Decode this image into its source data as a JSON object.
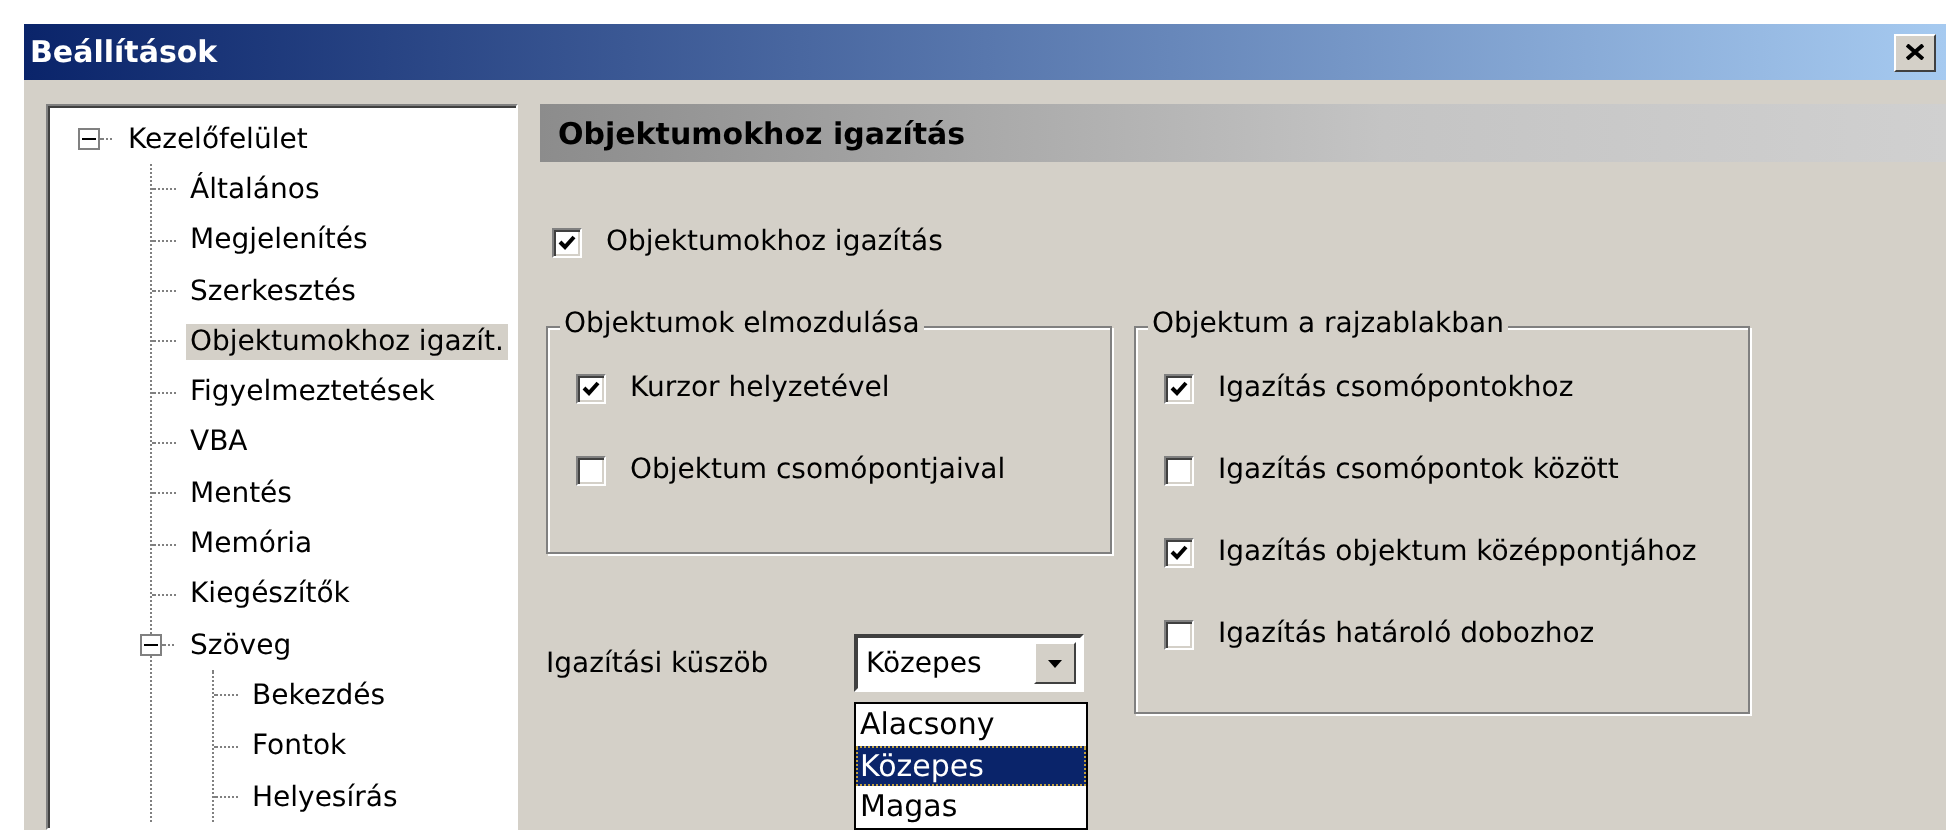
{
  "window": {
    "title": "Beállítások"
  },
  "tree": [
    {
      "label": "Kezelőfelület",
      "expanded": true,
      "selected": false,
      "children": [
        {
          "label": "Általános",
          "selected": false
        },
        {
          "label": "Megjelenítés",
          "selected": false
        },
        {
          "label": "Szerkesztés",
          "selected": false
        },
        {
          "label": "Objektumokhoz igazít.",
          "selected": true
        },
        {
          "label": "Figyelmeztetések",
          "selected": false
        },
        {
          "label": "VBA",
          "selected": false
        },
        {
          "label": "Mentés",
          "selected": false
        },
        {
          "label": "Memória",
          "selected": false
        },
        {
          "label": "Kiegészítők",
          "selected": false
        },
        {
          "label": "Szöveg",
          "expanded": true,
          "selected": false,
          "children": [
            {
              "label": "Bekezdés",
              "selected": false
            },
            {
              "label": "Fontok",
              "selected": false
            },
            {
              "label": "Helyesírás",
              "selected": false
            }
          ]
        }
      ]
    }
  ],
  "panel": {
    "title": "Objektumokhoz igazítás",
    "snap_checkbox": {
      "label": "Objektumokhoz igazítás",
      "checked": true
    },
    "groups": [
      {
        "title": "Objektumok elmozdulása",
        "options": [
          {
            "label": "Kurzor helyzetével",
            "checked": true
          },
          {
            "label": "Objektum csomópontjaival",
            "checked": false
          }
        ]
      },
      {
        "title": "Objektum a rajzablakban",
        "options": [
          {
            "label": "Igazítás csomópontokhoz",
            "checked": true
          },
          {
            "label": "Igazítás csomópontok között",
            "checked": false
          },
          {
            "label": "Igazítás objektum középpontjához",
            "checked": true
          },
          {
            "label": "Igazítás határoló dobozhoz",
            "checked": false
          }
        ]
      }
    ],
    "threshold": {
      "label": "Igazítási küszöb",
      "value": "Közepes",
      "expanded": true,
      "options": [
        {
          "label": "Alacsony",
          "selected": false
        },
        {
          "label": "Közepes",
          "selected": true
        },
        {
          "label": "Magas",
          "selected": false
        }
      ]
    }
  }
}
